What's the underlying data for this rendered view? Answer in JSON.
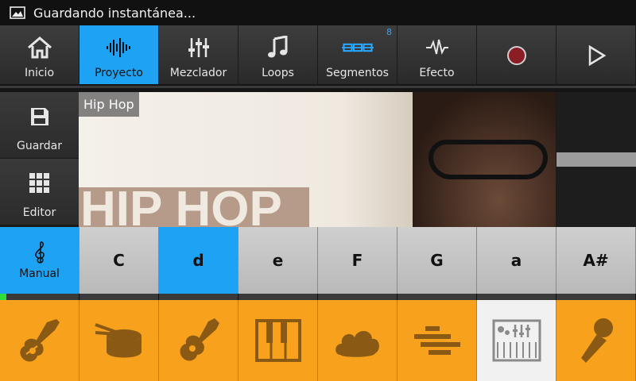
{
  "status": {
    "title": "Guardando instantánea..."
  },
  "toolbar": {
    "items": [
      {
        "label": "Inicio",
        "icon": "home-icon"
      },
      {
        "label": "Proyecto",
        "icon": "waveform-icon",
        "active": true
      },
      {
        "label": "Mezclador",
        "icon": "mixer-icon"
      },
      {
        "label": "Loops",
        "icon": "music-note-icon"
      },
      {
        "label": "Segmentos",
        "icon": "segments-icon",
        "badge": "8"
      },
      {
        "label": "Efecto",
        "icon": "effect-wave-icon"
      },
      {
        "label": "",
        "icon": "record-icon"
      },
      {
        "label": "",
        "icon": "play-icon"
      }
    ]
  },
  "left": {
    "save": "Guardar",
    "editor": "Editor"
  },
  "artwork": {
    "genre": "Hip Hop",
    "cover_text": "HIP HOP"
  },
  "keys": {
    "manual": "Manual",
    "notes": [
      "C",
      "d",
      "e",
      "F",
      "G",
      "a",
      "A#"
    ],
    "active_note": "d"
  },
  "instruments": [
    {
      "name": "electric-guitar-icon"
    },
    {
      "name": "drum-icon"
    },
    {
      "name": "acoustic-guitar-icon"
    },
    {
      "name": "piano-icon"
    },
    {
      "name": "cloud-pad-icon"
    },
    {
      "name": "bass-lines-icon"
    },
    {
      "name": "synth-keyboard-icon",
      "active": true
    },
    {
      "name": "microphone-icon"
    }
  ],
  "colors": {
    "accent": "#1ea2f4",
    "instrument": "#f8a11c",
    "level": "#2ede37"
  }
}
